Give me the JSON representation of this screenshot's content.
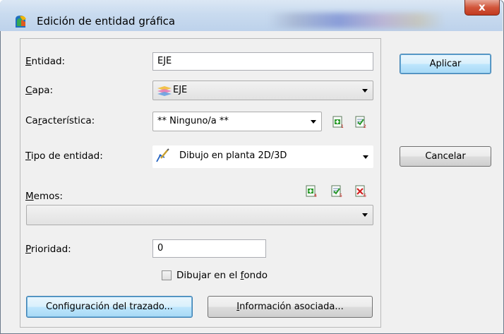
{
  "window": {
    "title": "Edición de entidad gráfica",
    "close_label": "x"
  },
  "form": {
    "entidad": {
      "label_first": "E",
      "label_rest": "ntidad:",
      "value": "EJE"
    },
    "capa": {
      "label_first": "C",
      "label_rest": "apa:",
      "value": "EJE"
    },
    "caracteristica": {
      "label_pre": "Ca",
      "label_u": "r",
      "label_post": "acterística:",
      "value": "** Ninguno/a **"
    },
    "tipo": {
      "label_first": "T",
      "label_rest": "ipo de entidad:",
      "value": "Dibujo en planta 2D/3D"
    },
    "memos": {
      "label_first": "M",
      "label_rest": "emos:",
      "value": ""
    },
    "prioridad": {
      "label_first": "P",
      "label_rest": "rioridad:",
      "value": "0"
    },
    "dibujar_fondo": {
      "label_pre": "Dibujar en el ",
      "label_u": "f",
      "label_post": "ondo",
      "checked": false
    }
  },
  "buttons": {
    "aplicar": "Aplicar",
    "cancelar": "Cancelar",
    "configuracion": "Configuración del trazado...",
    "informacion_u": "I",
    "informacion_rest": "nformación asociada..."
  },
  "mini_icons": {
    "char_add": {
      "icon": "add-sheet-icon",
      "sub": "1"
    },
    "char_edit": {
      "icon": "edit-sheet-icon",
      "sub": "2"
    },
    "memo_add": {
      "icon": "add-sheet-icon",
      "sub": "4"
    },
    "memo_edit": {
      "icon": "edit-sheet-icon",
      "sub": "5"
    },
    "memo_delete": {
      "icon": "delete-sheet-icon",
      "sub": "6"
    }
  },
  "colors": {
    "titlebar": "#c9dbef",
    "close": "#c7442a",
    "default_button_border": "#3c7fb1",
    "add_green": "#2a9a2a",
    "delete_red": "#d02020"
  }
}
